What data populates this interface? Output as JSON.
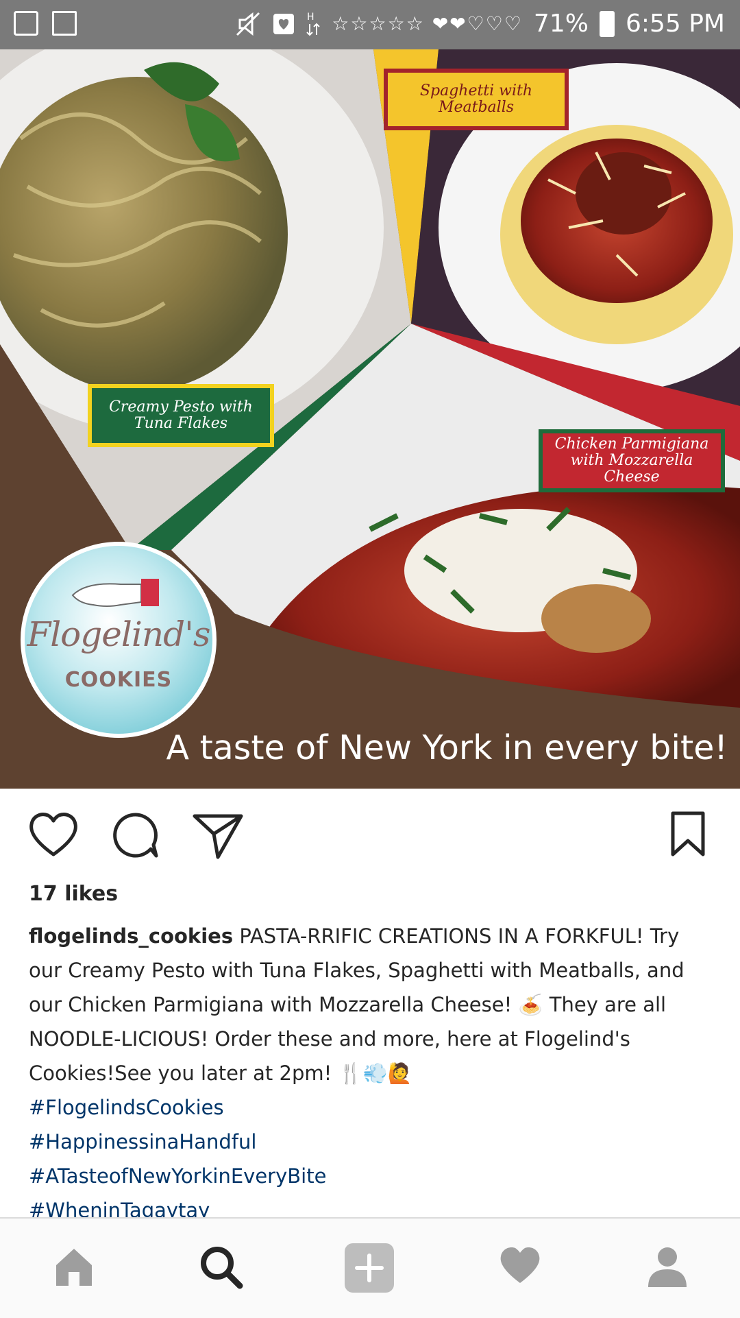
{
  "status_bar": {
    "battery": "71%",
    "time": "6:55 PM",
    "icons": [
      "gallery-icon",
      "recycle-icon",
      "mute-icon",
      "heart-notification-icon",
      "network-h-icon",
      "battery-icon"
    ],
    "notifications": "☆☆☆☆☆ ❤❤♡♡♡"
  },
  "post_image": {
    "labels": {
      "spaghetti": "Spaghetti with Meatballs",
      "pesto": "Creamy Pesto with Tuna Flakes",
      "chicken": "Chicken Parmigiana with Mozzarella Cheese"
    },
    "logo_script": "Flogelind's",
    "logo_cookies": "COOKIES",
    "tagline": "A taste of New York in every bite!",
    "colors": {
      "brown": "#5e4230",
      "yellow": "#f4c52c",
      "green": "#1d6a3e",
      "red": "#c22730"
    }
  },
  "actions": {
    "icons": [
      "heart-icon",
      "comment-icon",
      "share-icon",
      "bookmark-icon"
    ]
  },
  "post": {
    "likes": "17 likes",
    "username": "flogelinds_cookies",
    "caption": "PASTA-RRIFIC CREATIONS IN A FORKFUL! Try our Creamy Pesto with Tuna Flakes, Spaghetti with Meatballs, and our Chicken Parmigiana with Mozzarella Cheese! 🍝 They are all NOODLE-LICIOUS! Order these and more, here at Flogelind's Cookies!See you later at 2pm! 🍴💨🙋",
    "hashtags": [
      "#FlogelindsCookies",
      "#HappinessinaHandful",
      "#ATasteofNewYorkinEveryBite",
      "#WheninTagaytay"
    ]
  },
  "bottom_nav": {
    "items": [
      "home-icon",
      "search-icon",
      "add-post-icon",
      "activity-heart-icon",
      "profile-icon"
    ],
    "active": "search-icon"
  }
}
